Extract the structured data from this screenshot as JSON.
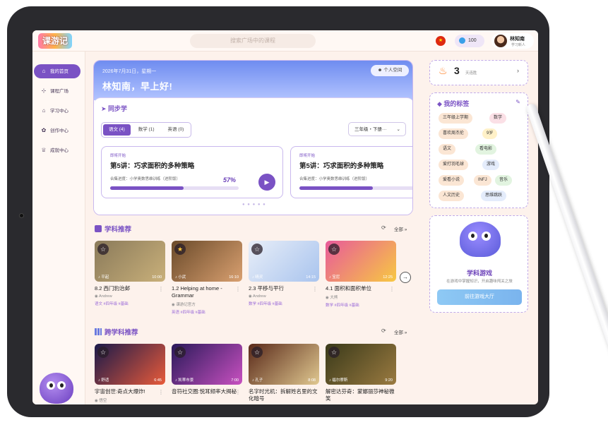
{
  "app": {
    "logo_text": "课游记"
  },
  "search": {
    "placeholder": "搜索广场中的课程"
  },
  "topbar": {
    "coins": "100",
    "user_name": "林知南",
    "user_role": "学习新人"
  },
  "sidebar": {
    "items": [
      {
        "label": "我的首页",
        "icon": "home-icon",
        "glyph": "⌂",
        "active": true
      },
      {
        "label": "课程广场",
        "icon": "grid-icon",
        "glyph": "⊹",
        "active": false
      },
      {
        "label": "学习中心",
        "icon": "graduation-cap-icon",
        "glyph": "⌂",
        "active": false
      },
      {
        "label": "创作中心",
        "icon": "palette-icon",
        "glyph": "✿",
        "active": false
      },
      {
        "label": "成就中心",
        "icon": "trophy-icon",
        "glyph": "♕",
        "active": false
      }
    ]
  },
  "greeting": {
    "date": "2026年7月31日，星期一",
    "hello": "林知南，早上好!",
    "my_space": "个人空间"
  },
  "sync": {
    "title": "同步学",
    "tabs": [
      {
        "label": "语文 (4)",
        "active": true
      },
      {
        "label": "数学 (1)",
        "active": false
      },
      {
        "label": "英语 (0)",
        "active": false
      }
    ],
    "grade": "三年级・下册···",
    "lessons": [
      {
        "badge": "即将开始",
        "title": "第5讲：巧求面积的多种策略",
        "subtitle": "合集进度：小学奥数思维训练（进阶版）",
        "percent": "57%",
        "progress": 0.57
      },
      {
        "badge": "即将开始",
        "title": "第5讲：巧求面积的多种策略",
        "subtitle": "合集进度：小学奥数思维训练（进阶版）",
        "percent": "",
        "progress": 0.57
      }
    ]
  },
  "subject": {
    "title": "学科推荐",
    "all": "全部",
    "cards": [
      {
        "teacher": "平起",
        "duration": "10:00",
        "title": "8.2 西门豹治邺",
        "author": "Andrew",
        "tags": "语文 #四年级 #基础",
        "starred": false,
        "c1": "#8a7a5a",
        "c2": "#c9b07a"
      },
      {
        "teacher": "小武",
        "duration": "16:10",
        "title": "1.2 Helping at home - Grammar",
        "author": "课游记官方",
        "tags": "英语 #四年级 #基础",
        "starred": true,
        "c1": "#6a4a2a",
        "c2": "#d9a070"
      },
      {
        "teacher": "晴灵",
        "duration": "14:15",
        "title": "2.3 平移与平行",
        "author": "Andrew",
        "tags": "数学 #四年级 #基础",
        "starred": false,
        "c1": "#e8eef8",
        "c2": "#a9c4ee"
      },
      {
        "teacher": "宝尼",
        "duration": "12:25",
        "title": "4.1 面积和面积单位",
        "author": "大熊",
        "tags": "数学 #四年级 #基础",
        "starred": false,
        "c1": "#e85a9a",
        "c2": "#f7c842"
      }
    ]
  },
  "cross": {
    "title": "跨学科推荐",
    "all": "全部",
    "cards": [
      {
        "teacher": "舒适",
        "duration": "6:45",
        "title": "宇宙创世:奇点大爆炸!",
        "author": "悟空",
        "c1": "#1a1a4a",
        "c2": "#e85a3a"
      },
      {
        "teacher": "凯蒂市景",
        "duration": "7:00",
        "title": "音符社交圈:悦耳频率大揭秘",
        "author": "",
        "c1": "#2a1a5a",
        "c2": "#c850c0"
      },
      {
        "teacher": "孔子",
        "duration": "8:08",
        "title": "名字时光机：拆解姓名里的文化暗号",
        "author": "",
        "c1": "#5a2a1a",
        "c2": "#e0c890"
      },
      {
        "teacher": "福尔摩斯",
        "duration": "9:20",
        "title": "解密达芬奇：蒙娜丽莎神秘微笑",
        "author": "",
        "c1": "#3a3a1a",
        "c2": "#9a7a40"
      }
    ]
  },
  "streak": {
    "days": "3",
    "label": "天连胜"
  },
  "tags": {
    "title": "我的标签",
    "items": [
      {
        "label": "三年级上学期",
        "bg": "#fbe6d4"
      },
      {
        "label": "数学",
        "bg": "#fbe0e6"
      },
      {
        "label": "喜欢周杰伦",
        "bg": "#fbe6d4"
      },
      {
        "label": "9岁",
        "bg": "#fff1c8"
      },
      {
        "label": "语文",
        "bg": "#fbe6d4"
      },
      {
        "label": "看电影",
        "bg": "#e2f4e0"
      },
      {
        "label": "爱打羽毛球",
        "bg": "#fbe6d4"
      },
      {
        "label": "游戏",
        "bg": "#e4ecfb"
      },
      {
        "label": "爱看小说",
        "bg": "#fbe6d4"
      },
      {
        "label": "INFJ",
        "bg": "#fbe6d4"
      },
      {
        "label": "音乐",
        "bg": "#e2f4e0"
      },
      {
        "label": "人文历史",
        "bg": "#fbe6d4"
      },
      {
        "label": "思维跳跃",
        "bg": "#e4ecfb"
      }
    ]
  },
  "game": {
    "title": "学科游戏",
    "subtitle": "在游戏中掌握知识，开启趣味闯关之旅",
    "button": "前往游戏大厅"
  }
}
